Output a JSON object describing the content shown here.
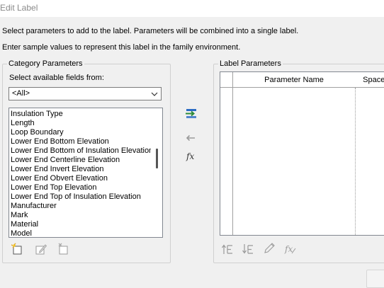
{
  "window": {
    "title": "Edit Label"
  },
  "instructions": {
    "line1": "Select parameters to add to the label.  Parameters will be combined into a single label.",
    "line2": "Enter sample values to represent this label in the family environment."
  },
  "category": {
    "legend": "Category Parameters",
    "fields_label": "Select available fields from:",
    "combo_value": "<All>",
    "items": [
      "Insulation Type",
      "Length",
      "Loop Boundary",
      "Lower End Bottom Elevation",
      "Lower End Bottom of Insulation Elevation",
      "Lower End Centerline Elevation",
      "Lower End Invert Elevation",
      "Lower End Obvert Elevation",
      "Lower End Top Elevation",
      "Lower End Top of Insulation Elevation",
      "Manufacturer",
      "Mark",
      "Material",
      "Model"
    ]
  },
  "label_params": {
    "legend": "Label Parameters",
    "columns": [
      "Parameter Name",
      "Spaces"
    ]
  },
  "colors": {
    "accent_green": "#2e8b3a",
    "accent_blue": "#2b6cc4",
    "icon_gray": "#9a9a9a"
  }
}
